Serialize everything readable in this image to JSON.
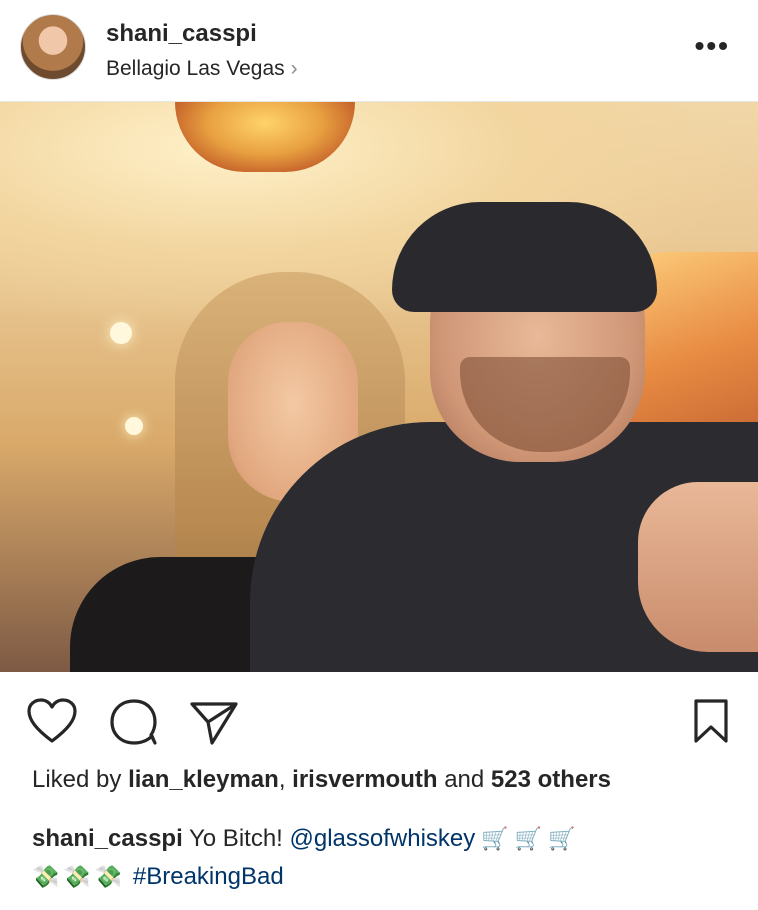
{
  "post": {
    "username": "shani_casspi",
    "location": "Bellagio Las Vegas",
    "location_chevron": "›",
    "more_label": "•••"
  },
  "actions": {
    "like_icon": "heart-icon",
    "comment_icon": "comment-icon",
    "share_icon": "paper-plane-icon",
    "save_icon": "bookmark-icon"
  },
  "likes": {
    "prefix": "Liked by ",
    "user1": "lian_kleyman",
    "sep": ", ",
    "user2": "irisvermouth",
    "mid": " and ",
    "others": "523 others"
  },
  "caption": {
    "username": "shani_casspi",
    "text": " Yo Bitch! ",
    "mention": "@glassofwhiskey",
    "emoji_cart": "🛒",
    "emoji_money": "💸",
    "hashtag": "#BreakingBad"
  }
}
